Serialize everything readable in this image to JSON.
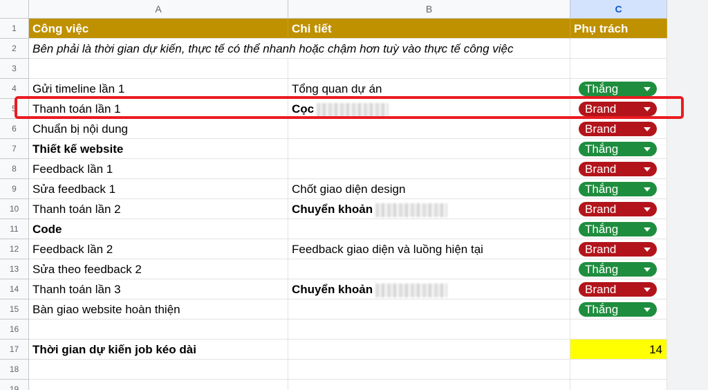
{
  "columns": [
    "A",
    "B",
    "C"
  ],
  "rows": [
    "1",
    "2",
    "3",
    "4",
    "5",
    "6",
    "7",
    "8",
    "9",
    "10",
    "11",
    "12",
    "13",
    "14",
    "15",
    "16",
    "17",
    "18",
    "19"
  ],
  "header": {
    "col_a": "Công việc",
    "col_b": "Chi tiết",
    "col_c": "Phụ trách"
  },
  "note": "Bên phải là thời gian dự kiến, thực tế có thể nhanh hoặc chậm hơn tuỳ vào thực tế công việc",
  "tasks": [
    {
      "task": "Gửi timeline lần 1",
      "detail": "Tổng quan dự án",
      "owner": "Thắng"
    },
    {
      "task": "Thanh toán lần 1",
      "detail": "Cọc",
      "owner": "Brand"
    },
    {
      "task": "Chuẩn bị nội dung",
      "detail": "",
      "owner": "Brand"
    },
    {
      "task": "Thiết kế website",
      "detail": "",
      "owner": "Thắng"
    },
    {
      "task": "Feedback lần 1",
      "detail": "",
      "owner": "Brand"
    },
    {
      "task": "Sửa feedback 1",
      "detail": "Chốt giao diện design",
      "owner": "Thắng"
    },
    {
      "task": "Thanh toán lần 2",
      "detail": "Chuyển khoản",
      "owner": "Brand"
    },
    {
      "task": "Code",
      "detail": "",
      "owner": "Thắng"
    },
    {
      "task": "Feedback lần 2",
      "detail": "Feedback giao diện và luồng hiện tại",
      "owner": "Brand"
    },
    {
      "task": "Sửa theo feedback 2",
      "detail": "",
      "owner": "Thắng"
    },
    {
      "task": "Thanh toán lần 3",
      "detail": "Chuyển khoản",
      "owner": "Brand"
    },
    {
      "task": "Bàn giao website hoàn thiện",
      "detail": "",
      "owner": "Thắng"
    }
  ],
  "summary": {
    "label": "Thời gian dự kiến job kéo dài",
    "value": "14"
  },
  "colors": {
    "header_bg": "#bf9000",
    "chip_thang": "#1e8e3e",
    "chip_brand": "#b3141b",
    "highlight": "#ea1b22",
    "summary_value_bg": "#ffff00"
  }
}
